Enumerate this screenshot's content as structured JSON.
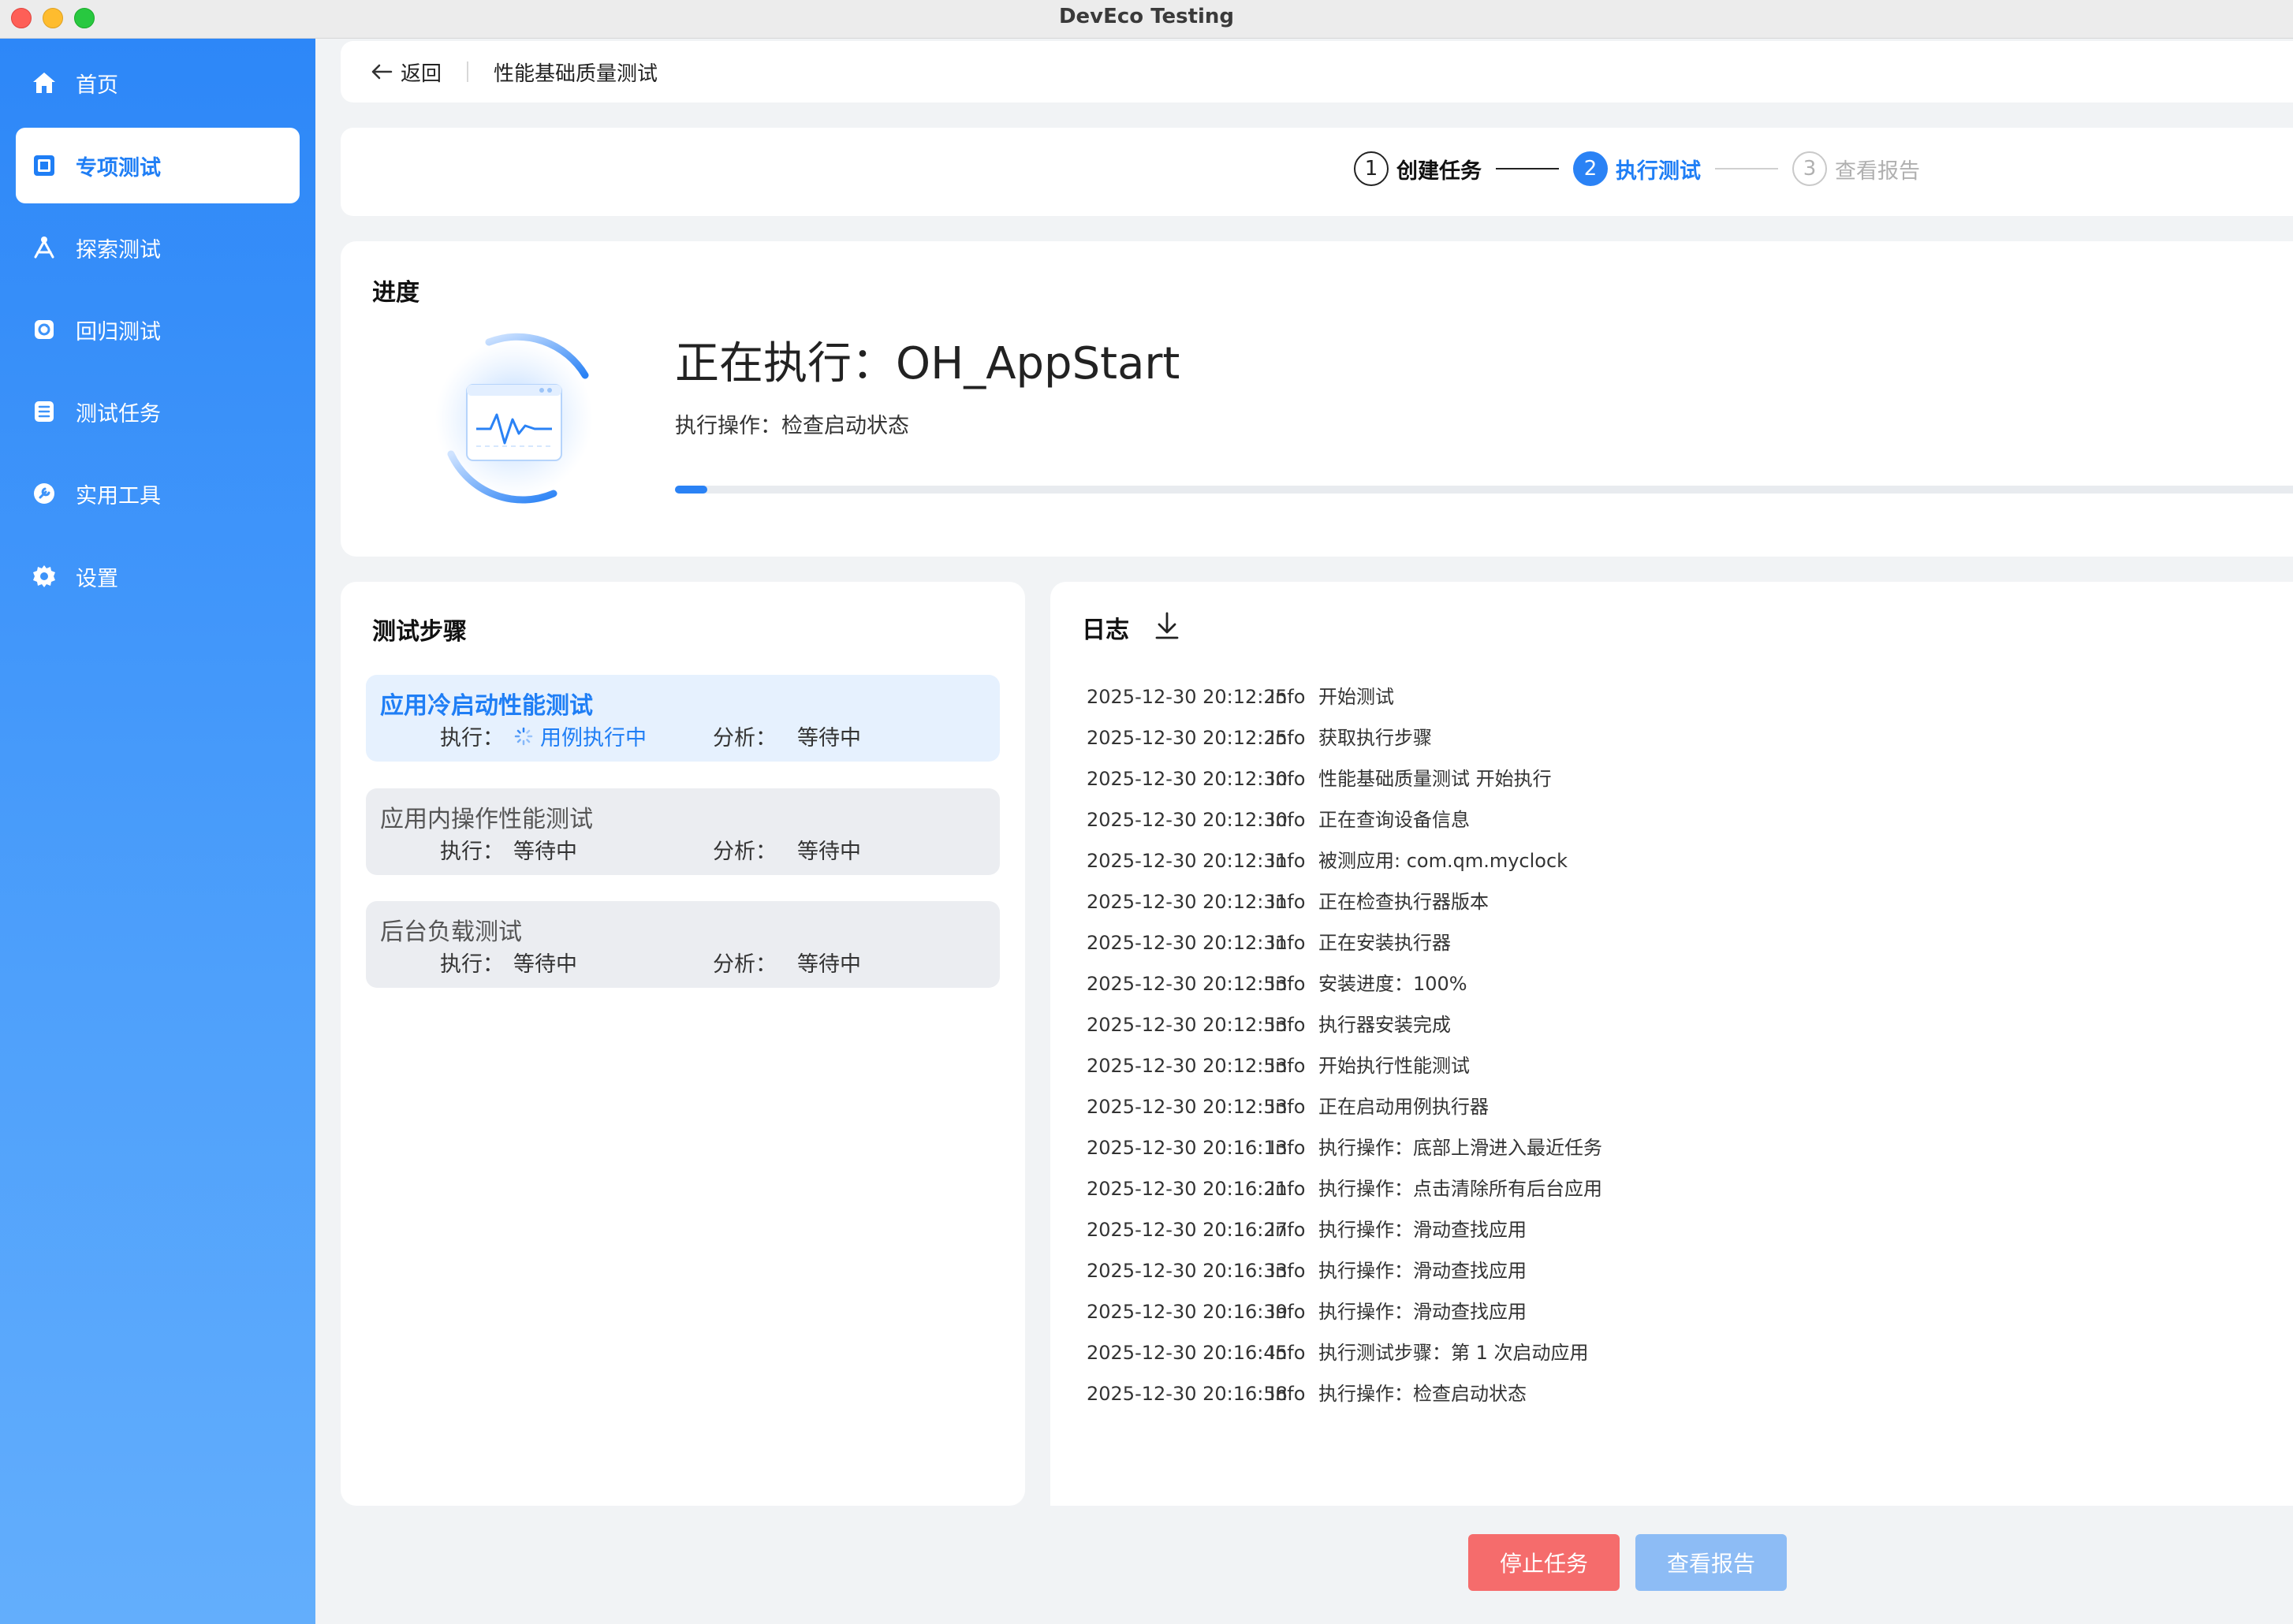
{
  "window": {
    "title": "DevEco Testing"
  },
  "sidebar": {
    "items": [
      {
        "label": "首页",
        "icon": "home-icon",
        "active": false
      },
      {
        "label": "专项测试",
        "icon": "special-test-icon",
        "active": true
      },
      {
        "label": "探索测试",
        "icon": "explore-icon",
        "active": false
      },
      {
        "label": "回归测试",
        "icon": "regression-icon",
        "active": false
      },
      {
        "label": "测试任务",
        "icon": "task-list-icon",
        "active": false
      },
      {
        "label": "实用工具",
        "icon": "tool-icon",
        "active": false
      },
      {
        "label": "设置",
        "icon": "gear-icon",
        "active": false
      }
    ]
  },
  "breadcrumb": {
    "back_label": "返回",
    "page_title": "性能基础质量测试"
  },
  "stepper": {
    "steps": [
      {
        "num": "1",
        "label": "创建任务",
        "state": "done"
      },
      {
        "num": "2",
        "label": "执行测试",
        "state": "active"
      },
      {
        "num": "3",
        "label": "查看报告",
        "state": "todo"
      }
    ]
  },
  "progress": {
    "section_title": "进度",
    "running_title": "正在执行：OH_AppStart",
    "operation": "执行操作：检查启动状态",
    "fraction": 0.02
  },
  "test_steps": {
    "section_title": "测试步骤",
    "exec_label": "执行：",
    "analysis_label": "分析：",
    "items": [
      {
        "name": "应用冷启动性能测试",
        "exec_status": "用例执行中",
        "analysis_status": "等待中",
        "active": true
      },
      {
        "name": "应用内操作性能测试",
        "exec_status": "等待中",
        "analysis_status": "等待中",
        "active": false
      },
      {
        "name": "后台负载测试",
        "exec_status": "等待中",
        "analysis_status": "等待中",
        "active": false
      }
    ]
  },
  "log": {
    "section_title": "日志",
    "lines": [
      {
        "ts": "2025-12-30 20:12:25",
        "level": "Info",
        "msg": "开始测试"
      },
      {
        "ts": "2025-12-30 20:12:25",
        "level": "Info",
        "msg": "获取执行步骤"
      },
      {
        "ts": "2025-12-30 20:12:30",
        "level": "Info",
        "msg": "性能基础质量测试 开始执行"
      },
      {
        "ts": "2025-12-30 20:12:30",
        "level": "Info",
        "msg": "正在查询设备信息"
      },
      {
        "ts": "2025-12-30 20:12:31",
        "level": "Info",
        "msg": "被测应用: com.qm.myclock"
      },
      {
        "ts": "2025-12-30 20:12:31",
        "level": "Info",
        "msg": "正在检查执行器版本"
      },
      {
        "ts": "2025-12-30 20:12:31",
        "level": "Info",
        "msg": "正在安装执行器"
      },
      {
        "ts": "2025-12-30 20:12:53",
        "level": "Info",
        "msg": "安装进度：100%"
      },
      {
        "ts": "2025-12-30 20:12:53",
        "level": "Info",
        "msg": "执行器安装完成"
      },
      {
        "ts": "2025-12-30 20:12:53",
        "level": "Info",
        "msg": "开始执行性能测试"
      },
      {
        "ts": "2025-12-30 20:12:53",
        "level": "Info",
        "msg": "正在启动用例执行器"
      },
      {
        "ts": "2025-12-30 20:16:13",
        "level": "Info",
        "msg": "执行操作：底部上滑进入最近任务"
      },
      {
        "ts": "2025-12-30 20:16:21",
        "level": "Info",
        "msg": "执行操作：点击清除所有后台应用"
      },
      {
        "ts": "2025-12-30 20:16:27",
        "level": "Info",
        "msg": "执行操作：滑动查找应用"
      },
      {
        "ts": "2025-12-30 20:16:33",
        "level": "Info",
        "msg": "执行操作：滑动查找应用"
      },
      {
        "ts": "2025-12-30 20:16:39",
        "level": "Info",
        "msg": "执行操作：滑动查找应用"
      },
      {
        "ts": "2025-12-30 20:16:45",
        "level": "Info",
        "msg": "执行测试步骤：第 1 次启动应用"
      },
      {
        "ts": "2025-12-30 20:16:58",
        "level": "Info",
        "msg": "执行操作：检查启动状态"
      }
    ]
  },
  "actions": {
    "stop_label": "停止任务",
    "report_label": "查看报告"
  },
  "colors": {
    "accent": "#2a82f5",
    "danger": "#f56c6c",
    "disabled_primary": "#8dbcf5"
  }
}
